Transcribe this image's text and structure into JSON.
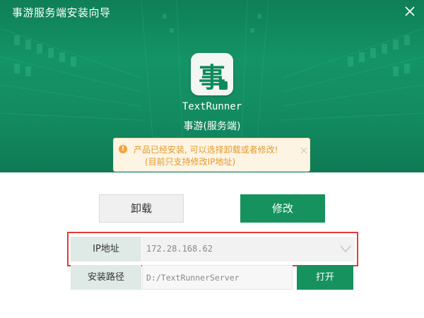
{
  "window": {
    "title": "事游服务端安装向导",
    "close_icon": "close-icon"
  },
  "app": {
    "icon_glyph": "事",
    "name": "TextRunner",
    "subtitle": "事游(服务端)"
  },
  "notice": {
    "icon": "warning-icon",
    "line1": "产品已经安装, 可以选择卸载或者修改!",
    "line2": "(目前只支持修改IP地址)",
    "dismiss_icon": "close-icon"
  },
  "actions": {
    "uninstall_label": "卸载",
    "modify_label": "修改"
  },
  "form": {
    "ip_label": "IP地址",
    "ip_value": "172.28.168.62",
    "path_label": "安装路径",
    "path_value": "D:/TextRunnerServer",
    "open_label": "打开"
  },
  "colors": {
    "brand_green": "#16925f",
    "hero_green": "#149466",
    "notice_bg": "#fdf4e3",
    "notice_text": "#e39a2d",
    "highlight_red": "#e23b3b"
  }
}
